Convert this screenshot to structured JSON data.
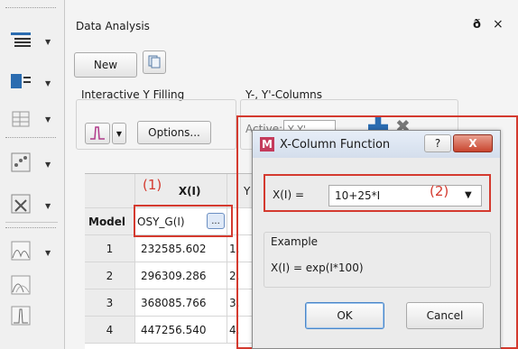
{
  "panel": {
    "title": "Data Analysis",
    "title_icons": [
      "restore-icon",
      "close-icon"
    ],
    "pin_glyph": "ð",
    "close_glyph": "×",
    "new_button": "New",
    "interactive_y_label": "Interactive Y Filling",
    "options_button": "Options...",
    "yy_columns_label": "Y-, Y'-Columns",
    "active_label": "Active:",
    "active_value": "Y,Y'"
  },
  "grid": {
    "header_col1": "X(I)",
    "header_col2": "Y",
    "model_label": "Model",
    "model_value": "OSY_G(I)",
    "ellipsis": "...",
    "rows": [
      {
        "index": "1",
        "x": "232585.602",
        "y": "1."
      },
      {
        "index": "2",
        "x": "296309.286",
        "y": "2."
      },
      {
        "index": "3",
        "x": "368085.766",
        "y": "3."
      },
      {
        "index": "4",
        "x": "447256.540",
        "y": "4."
      }
    ]
  },
  "annotations": {
    "label_1": "(1)",
    "label_2": "(2)",
    "color": "#d43a2f"
  },
  "dialog": {
    "title": "X-Column Function",
    "help_glyph": "?",
    "close_glyph": "X",
    "field_label": "X(I) =",
    "field_value": "10+25*I",
    "example_label": "Example",
    "example_text": "X(I) = exp(I*100)",
    "ok": "OK",
    "cancel": "Cancel"
  }
}
